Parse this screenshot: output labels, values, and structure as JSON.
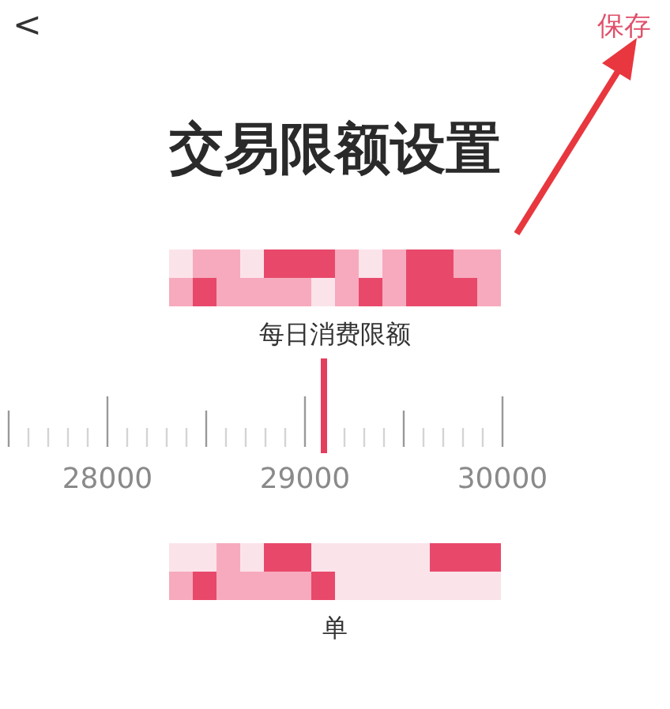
{
  "header": {
    "back": "<",
    "save": "保存"
  },
  "title": "交易限额设置",
  "limits": [
    {
      "label": "每日消费限额",
      "scale_labels": [
        "28000",
        "29000",
        "30000"
      ]
    },
    {
      "label": "单"
    }
  ]
}
